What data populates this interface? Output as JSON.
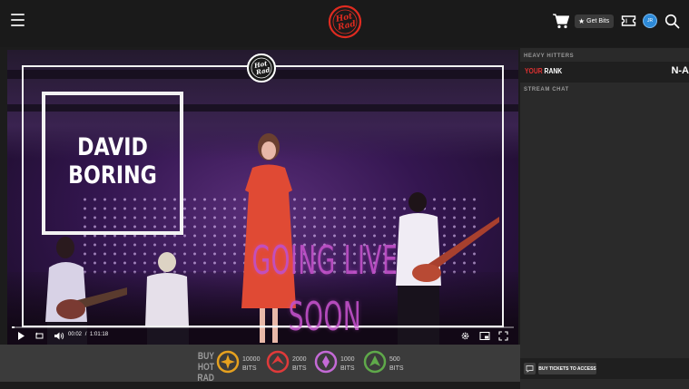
{
  "header": {
    "get_bits_label": "Get Bits",
    "avatar_initials": "JR",
    "icons": [
      "hamburger-menu-icon",
      "hot-rad-logo",
      "cart-icon",
      "star-icon",
      "ticket-icon",
      "search-icon"
    ],
    "accent_color": "#e02b20"
  },
  "video": {
    "band_name_line1": "DAVID",
    "band_name_line2": "BORING",
    "overlay_text": "GOING LIVE SOON",
    "controls": {
      "current_time": "00:02",
      "separator": "/",
      "duration": "1:01:18",
      "progress": 0.0005
    }
  },
  "bits": {
    "heading_line1": "BUY HOT",
    "heading_line2": "RAD BITS",
    "unit": "BITS",
    "packs": [
      {
        "amount": "10000",
        "color": "#e6a11f"
      },
      {
        "amount": "2000",
        "color": "#e03a3a"
      },
      {
        "amount": "1000",
        "color": "#c46ad6"
      },
      {
        "amount": "500",
        "color": "#5fa94a"
      }
    ]
  },
  "sidebar": {
    "heavy_hitters_title": "HEAVY HITTERS",
    "rank_prefix": "YOUR",
    "rank_label": "RANK",
    "rank_value": "N-A",
    "stream_chat_title": "STREAM CHAT",
    "tickets_button_label": "BUY TICKETS TO ACCESS",
    "your_color": "#e03131"
  }
}
